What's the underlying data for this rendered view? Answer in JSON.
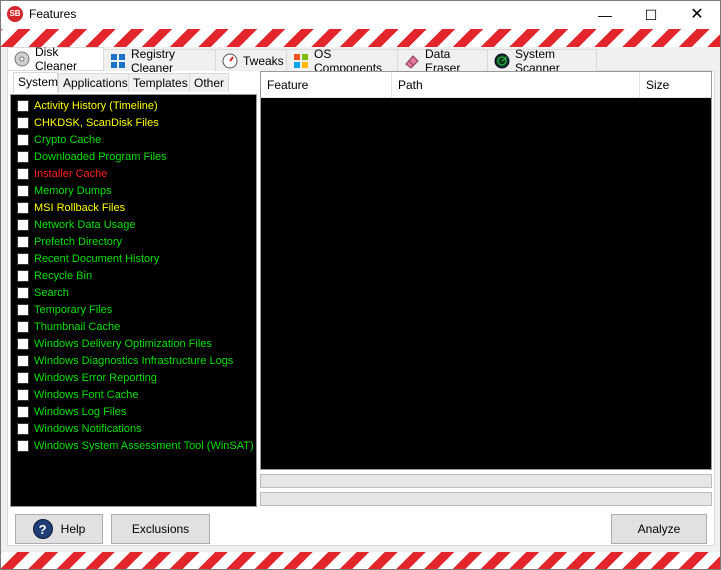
{
  "window": {
    "title": "Features",
    "icon_text": "SB",
    "minimize_icon": "minimize-icon",
    "maximize_icon": "maximize-icon",
    "close_icon": "close-icon"
  },
  "tabs": [
    {
      "label": "Disk Cleaner",
      "icon": "disk-icon",
      "active": true
    },
    {
      "label": "Registry Cleaner",
      "icon": "registry-icon",
      "active": false
    },
    {
      "label": "Tweaks",
      "icon": "gauge-icon",
      "active": false
    },
    {
      "label": "OS Components",
      "icon": "windows-icon",
      "active": false
    },
    {
      "label": "Data Eraser",
      "icon": "eraser-icon",
      "active": false
    },
    {
      "label": "System Scanner",
      "icon": "radar-icon",
      "active": false
    }
  ],
  "subtabs": [
    {
      "label": "System",
      "active": true
    },
    {
      "label": "Applications",
      "active": false
    },
    {
      "label": "Templates",
      "active": false
    },
    {
      "label": "Other",
      "active": false
    }
  ],
  "features": [
    {
      "label": "Activity History (Timeline)",
      "color": "#ffff00",
      "checked": false
    },
    {
      "label": "CHKDSK, ScanDisk Files",
      "color": "#ffff00",
      "checked": false
    },
    {
      "label": "Crypto Cache",
      "color": "#00e000",
      "checked": false
    },
    {
      "label": "Downloaded Program Files",
      "color": "#00e000",
      "checked": false
    },
    {
      "label": "Installer Cache",
      "color": "#ff2020",
      "checked": false
    },
    {
      "label": "Memory Dumps",
      "color": "#00e000",
      "checked": false
    },
    {
      "label": "MSI Rollback Files",
      "color": "#ffff00",
      "checked": false
    },
    {
      "label": "Network Data Usage",
      "color": "#00e000",
      "checked": false
    },
    {
      "label": "Prefetch Directory",
      "color": "#00e000",
      "checked": false
    },
    {
      "label": "Recent Document History",
      "color": "#00e000",
      "checked": false
    },
    {
      "label": "Recycle Bin",
      "color": "#00e000",
      "checked": false
    },
    {
      "label": "Search",
      "color": "#00e000",
      "checked": false
    },
    {
      "label": "Temporary Files",
      "color": "#00e000",
      "checked": false
    },
    {
      "label": "Thumbnail Cache",
      "color": "#00e000",
      "checked": false
    },
    {
      "label": "Windows Delivery Optimization Files",
      "color": "#00e000",
      "checked": false
    },
    {
      "label": "Windows Diagnostics Infrastructure Logs",
      "color": "#00e000",
      "checked": false
    },
    {
      "label": "Windows Error Reporting",
      "color": "#00e000",
      "checked": false
    },
    {
      "label": "Windows Font Cache",
      "color": "#00e000",
      "checked": false
    },
    {
      "label": "Windows Log Files",
      "color": "#00e000",
      "checked": false
    },
    {
      "label": "Windows Notifications",
      "color": "#00e000",
      "checked": false
    },
    {
      "label": "Windows System Assessment Tool (WinSAT)",
      "color": "#00e000",
      "checked": false
    }
  ],
  "results": {
    "columns": [
      "Feature",
      "Path",
      "Size"
    ],
    "rows": []
  },
  "buttons": {
    "help": "Help",
    "help_icon_text": "?",
    "exclusions": "Exclusions",
    "analyze": "Analyze"
  },
  "progress": [
    0,
    0
  ]
}
